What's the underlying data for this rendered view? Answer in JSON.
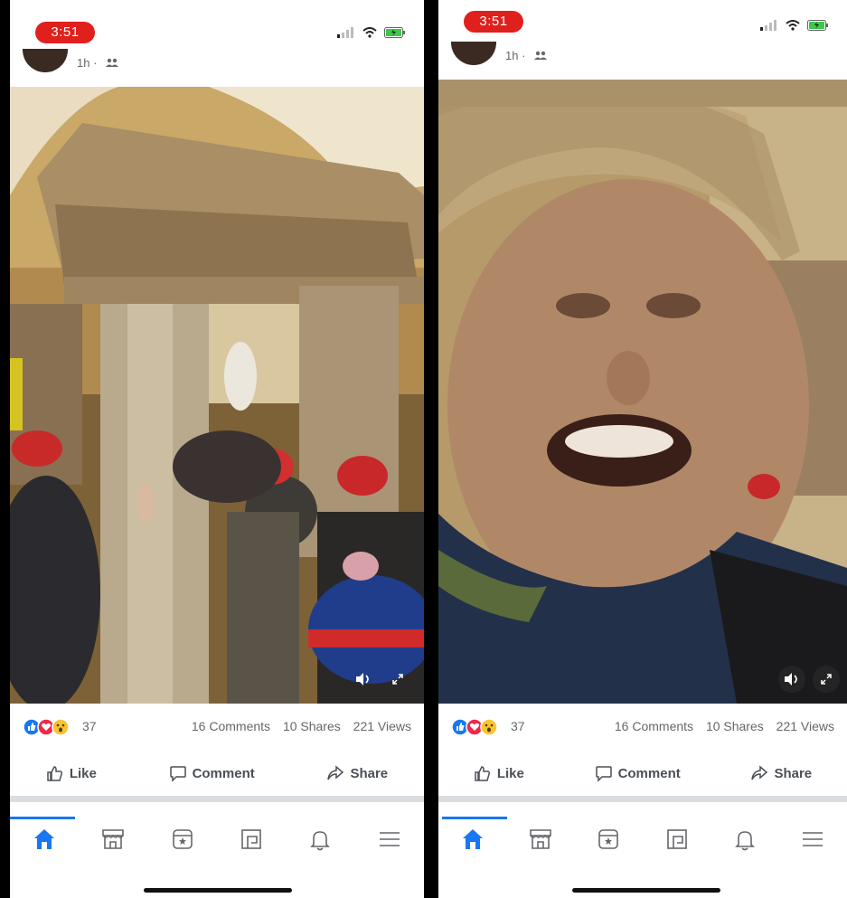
{
  "colors": {
    "time_pill": "#e0201c",
    "facebook_blue": "#1877f2",
    "text_gray": "#65676b"
  },
  "screens": [
    {
      "status": {
        "time": "3:51"
      },
      "post": {
        "timestamp": "1h ·"
      },
      "reactions": {
        "count": "37",
        "comments": "16 Comments",
        "shares": "10 Shares",
        "views": "221 Views"
      },
      "actions": {
        "like": "Like",
        "comment": "Comment",
        "share": "Share"
      },
      "tabs": [
        "home-icon",
        "marketplace-icon",
        "pages-icon",
        "feeds-icon",
        "notifications-icon",
        "menu-icon"
      ]
    },
    {
      "status": {
        "time": "3:51"
      },
      "post": {
        "timestamp": "1h ·"
      },
      "reactions": {
        "count": "37",
        "comments": "16 Comments",
        "shares": "10 Shares",
        "views": "221 Views"
      },
      "actions": {
        "like": "Like",
        "comment": "Comment",
        "share": "Share"
      },
      "tabs": [
        "home-icon",
        "marketplace-icon",
        "pages-icon",
        "feeds-icon",
        "notifications-icon",
        "menu-icon"
      ]
    }
  ]
}
